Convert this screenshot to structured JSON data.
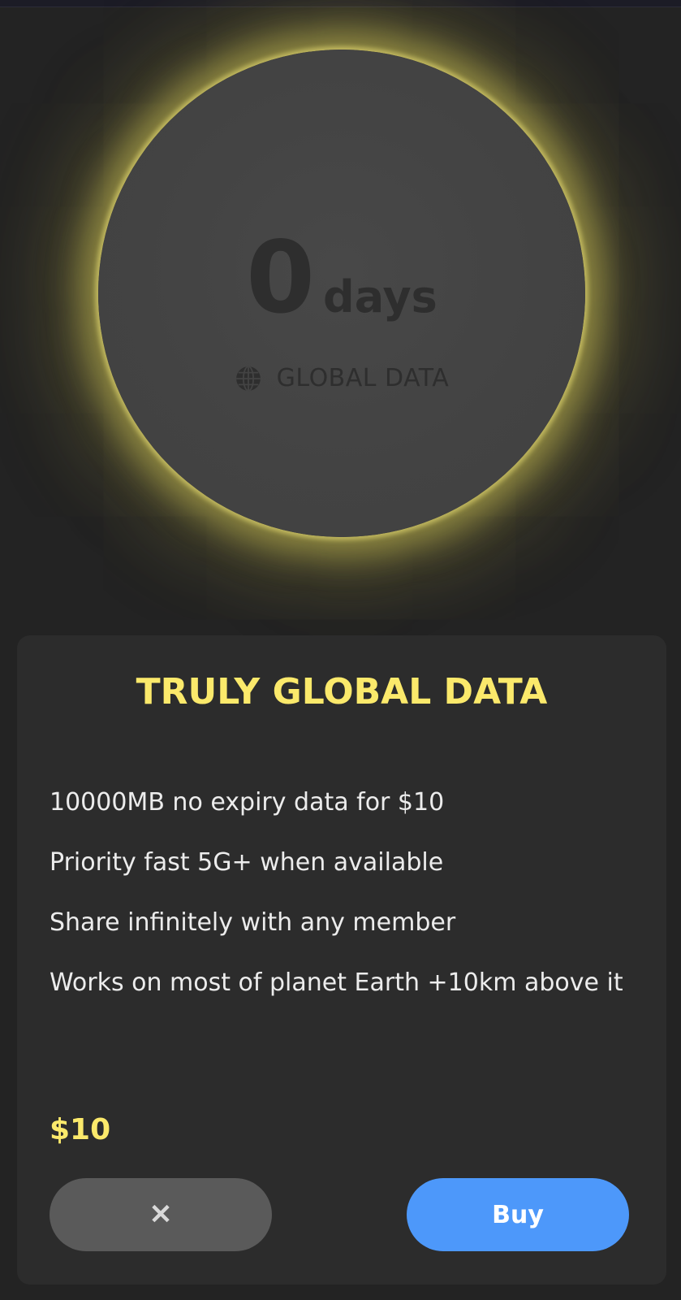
{
  "plan_circle": {
    "days_value": "0",
    "days_unit": "days",
    "data_type_label": "GLOBAL DATA",
    "icon": "globe-icon"
  },
  "card": {
    "title": "TRULY GLOBAL DATA",
    "features": [
      "10000MB no expiry data for $10",
      "Priority fast 5G+ when available",
      "Share infinitely with any member",
      "Works on most of planet Earth +10km above it"
    ],
    "price": "$10",
    "close_icon": "✕",
    "buy_label": "Buy"
  },
  "colors": {
    "accent_yellow": "#fbe96b",
    "buy_blue": "#4d98fa",
    "background": "#232323",
    "card": "#2c2c2c"
  }
}
